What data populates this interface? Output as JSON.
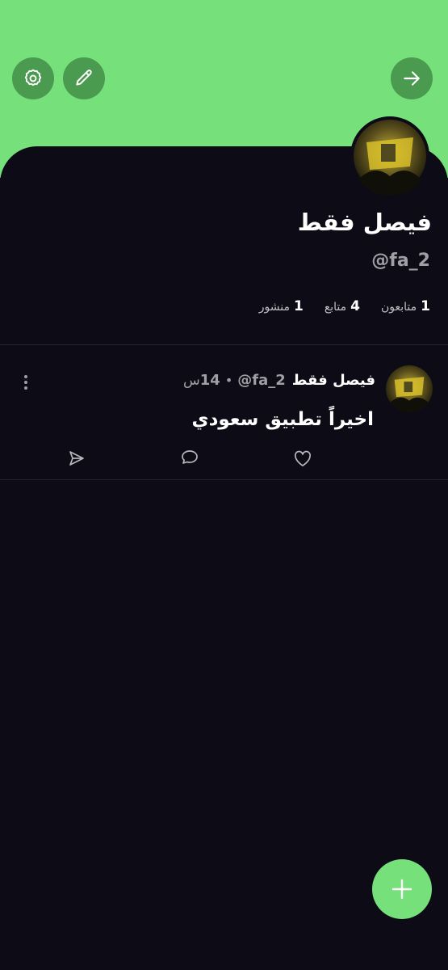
{
  "colors": {
    "accent": "#76e07b",
    "header_button": "#4a9a50",
    "background": "#0d0c16",
    "text_primary": "#ffffff",
    "text_secondary": "#9f9fa5",
    "divider": "#24232e"
  },
  "header": {
    "buttons": [
      {
        "icon": "gear-icon"
      },
      {
        "icon": "pencil-icon"
      },
      {
        "icon": "arrow-right-icon"
      }
    ]
  },
  "profile": {
    "name": "فيصل فقط",
    "handle": "@fa_2",
    "stats": [
      {
        "count": "1",
        "label": "متابعون"
      },
      {
        "count": "4",
        "label": "متابع"
      },
      {
        "count": "1",
        "label": "منشور"
      }
    ]
  },
  "post": {
    "author": "فيصل فقط",
    "handle": "@fa_2",
    "separator": "•",
    "time": "14",
    "time_unit": "س",
    "text": "اخيراً تطبيق سعودي",
    "actions": [
      {
        "icon": "heart-icon"
      },
      {
        "icon": "comment-icon"
      },
      {
        "icon": "send-icon"
      }
    ],
    "menu_icon": "more-vertical-icon"
  },
  "fab": {
    "icon": "plus-icon"
  }
}
